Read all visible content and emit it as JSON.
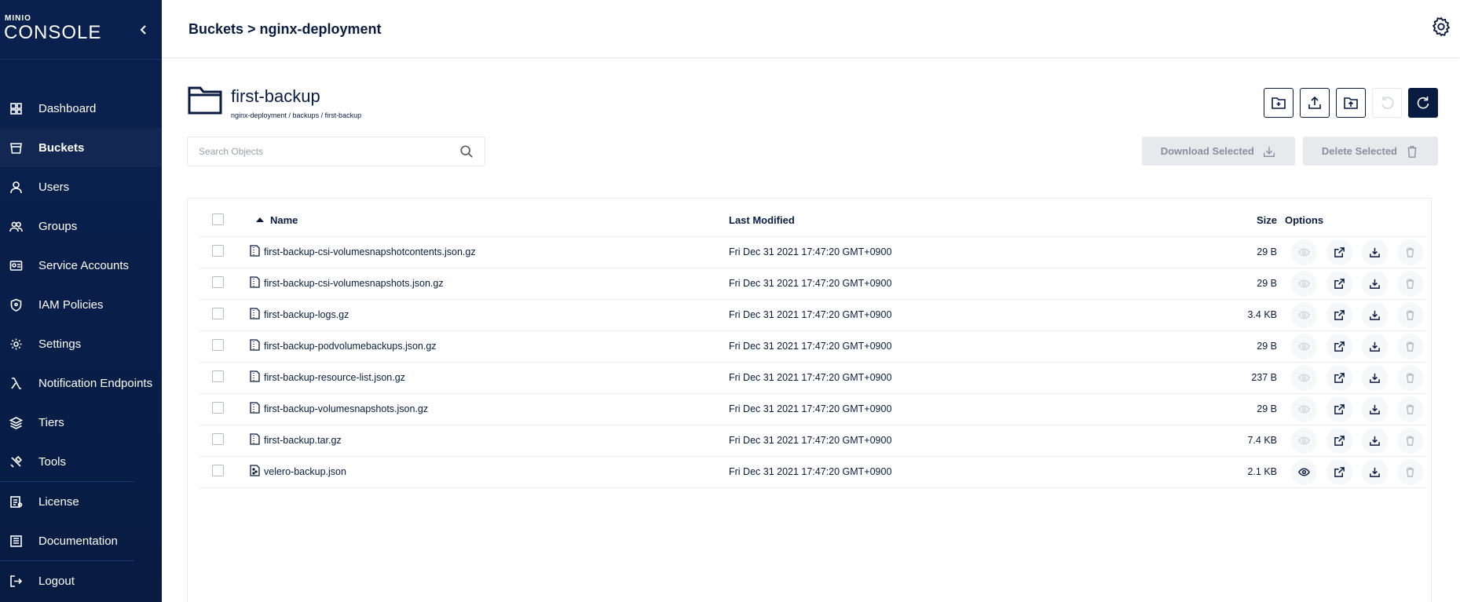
{
  "brand": {
    "mini": "MINIO",
    "console": "CONSOLE"
  },
  "nav": [
    {
      "label": "Dashboard",
      "icon": "dashboard-icon"
    },
    {
      "label": "Buckets",
      "icon": "bucket-icon",
      "active": true
    },
    {
      "label": "Users",
      "icon": "user-icon"
    },
    {
      "label": "Groups",
      "icon": "groups-icon"
    },
    {
      "label": "Service Accounts",
      "icon": "service-accounts-icon"
    },
    {
      "label": "IAM Policies",
      "icon": "shield-icon"
    },
    {
      "label": "Settings",
      "icon": "gear-icon"
    },
    {
      "label": "Notification Endpoints",
      "icon": "lambda-icon"
    },
    {
      "label": "Tiers",
      "icon": "tiers-icon"
    },
    {
      "label": "Tools",
      "icon": "tools-icon"
    },
    {
      "label": "License",
      "icon": "license-icon"
    },
    {
      "label": "Documentation",
      "icon": "documentation-icon"
    },
    {
      "label": "Logout",
      "icon": "logout-icon"
    }
  ],
  "topbar": {
    "breadcrumb_root": "Buckets",
    "breadcrumb_sep": " > ",
    "breadcrumb_current": "nginx-deployment"
  },
  "folder": {
    "title": "first-backup",
    "path": "nginx-deployment / backups / first-backup"
  },
  "search": {
    "placeholder": "Search Objects"
  },
  "bulk": {
    "download": "Download Selected",
    "delete": "Delete Selected"
  },
  "table": {
    "headers": {
      "name": "Name",
      "modified": "Last Modified",
      "size": "Size",
      "options": "Options"
    },
    "rows": [
      {
        "name": "first-backup-csi-volumesnapshotcontents.json.gz",
        "modified": "Fri Dec 31 2021 17:47:20 GMT+0900",
        "size": "29 B",
        "preview": false
      },
      {
        "name": "first-backup-csi-volumesnapshots.json.gz",
        "modified": "Fri Dec 31 2021 17:47:20 GMT+0900",
        "size": "29 B",
        "preview": false
      },
      {
        "name": "first-backup-logs.gz",
        "modified": "Fri Dec 31 2021 17:47:20 GMT+0900",
        "size": "3.4 KB",
        "preview": false
      },
      {
        "name": "first-backup-podvolumebackups.json.gz",
        "modified": "Fri Dec 31 2021 17:47:20 GMT+0900",
        "size": "29 B",
        "preview": false
      },
      {
        "name": "first-backup-resource-list.json.gz",
        "modified": "Fri Dec 31 2021 17:47:20 GMT+0900",
        "size": "237 B",
        "preview": false
      },
      {
        "name": "first-backup-volumesnapshots.json.gz",
        "modified": "Fri Dec 31 2021 17:47:20 GMT+0900",
        "size": "29 B",
        "preview": false
      },
      {
        "name": "first-backup.tar.gz",
        "modified": "Fri Dec 31 2021 17:47:20 GMT+0900",
        "size": "7.4 KB",
        "preview": false
      },
      {
        "name": "velero-backup.json",
        "modified": "Fri Dec 31 2021 17:47:20 GMT+0900",
        "size": "2.1 KB",
        "preview": true
      }
    ]
  },
  "colors": {
    "navy": "#081c42",
    "disabled": "#e8e9ec"
  }
}
